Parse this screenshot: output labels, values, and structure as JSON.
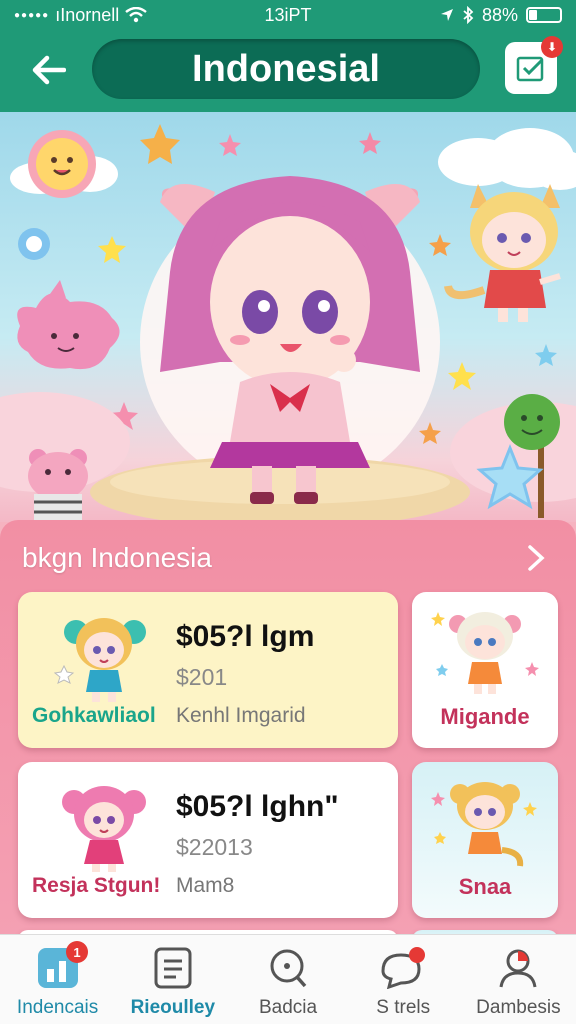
{
  "status_bar": {
    "carrier": "ıInornell",
    "time": "13iPT",
    "battery": "88%"
  },
  "header": {
    "title": "Indonesial"
  },
  "panel": {
    "title": "bkgn Indonesia",
    "cards": [
      {
        "price": "$05?l lgm",
        "sub": "$201",
        "name": "Gohkawliaol",
        "desc": "Kenhl Imgarid",
        "side_name": "Migande",
        "name_color": "#1aa58b"
      },
      {
        "price": "$05?l lghn\"",
        "sub": "$22013",
        "name": "Resja Stgun!",
        "desc": "Mam8",
        "side_name": "Snaa",
        "name_color": "#c3325b"
      }
    ]
  },
  "nav": {
    "items": [
      {
        "label": "Indencais",
        "icon": "chart-icon",
        "badge": "1"
      },
      {
        "label": "Rieoulley",
        "icon": "list-icon"
      },
      {
        "label": "Badcia",
        "icon": "search-icon"
      },
      {
        "label": "S trels",
        "icon": "chat-icon"
      },
      {
        "label": "Dambesis",
        "icon": "profile-icon"
      }
    ]
  }
}
